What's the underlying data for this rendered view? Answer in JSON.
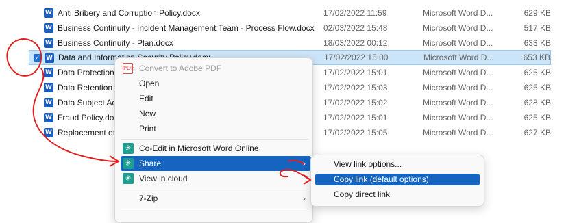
{
  "files": [
    {
      "name": "Anti Bribery and Corruption Policy.docx",
      "date": "17/02/2022 11:59",
      "type": "Microsoft Word D...",
      "size": "629 KB"
    },
    {
      "name": "Business Continuity - Incident Management Team - Process Flow.docx",
      "date": "02/03/2022 15:48",
      "type": "Microsoft Word D...",
      "size": "517 KB"
    },
    {
      "name": "Business Continuity - Plan.docx",
      "date": "18/03/2022 00:12",
      "type": "Microsoft Word D...",
      "size": "633 KB"
    },
    {
      "name": "Data and Information Security Policy.docx",
      "date": "17/02/2022 15:00",
      "type": "Microsoft Word D...",
      "size": "653 KB"
    },
    {
      "name": "Data Protection",
      "date": "17/02/2022 15:01",
      "type": "Microsoft Word D...",
      "size": "625 KB"
    },
    {
      "name": "Data Retention I",
      "date": "17/02/2022 15:03",
      "type": "Microsoft Word D...",
      "size": "625 KB"
    },
    {
      "name": "Data Subject Ac",
      "date": "17/02/2022 15:02",
      "type": "Microsoft Word D...",
      "size": "628 KB"
    },
    {
      "name": "Fraud Policy.doc",
      "date": "17/02/2022 15:01",
      "type": "Microsoft Word D...",
      "size": "625 KB"
    },
    {
      "name": "Replacement of",
      "date": "17/02/2022 15:05",
      "type": "Microsoft Word D...",
      "size": "627 KB"
    }
  ],
  "context_menu": {
    "convert": "Convert to Adobe PDF",
    "open": "Open",
    "edit": "Edit",
    "new": "New",
    "print": "Print",
    "coedit": "Co-Edit in Microsoft Word Online",
    "share": "Share",
    "view_cloud": "View in cloud",
    "zip": "7-Zip",
    "pdf_icon_text": "PDF"
  },
  "share_submenu": {
    "view_link_options": "View link options...",
    "copy_link": "Copy link (default options)",
    "copy_direct_link": "Copy direct link"
  },
  "icons": {
    "word": "W",
    "check": "✓",
    "cloud": "✳",
    "submenu_arrow": "›"
  },
  "colors": {
    "selection_bg": "#cce4f7",
    "menu_highlight": "#1565c0",
    "annotation": "#e02020"
  }
}
